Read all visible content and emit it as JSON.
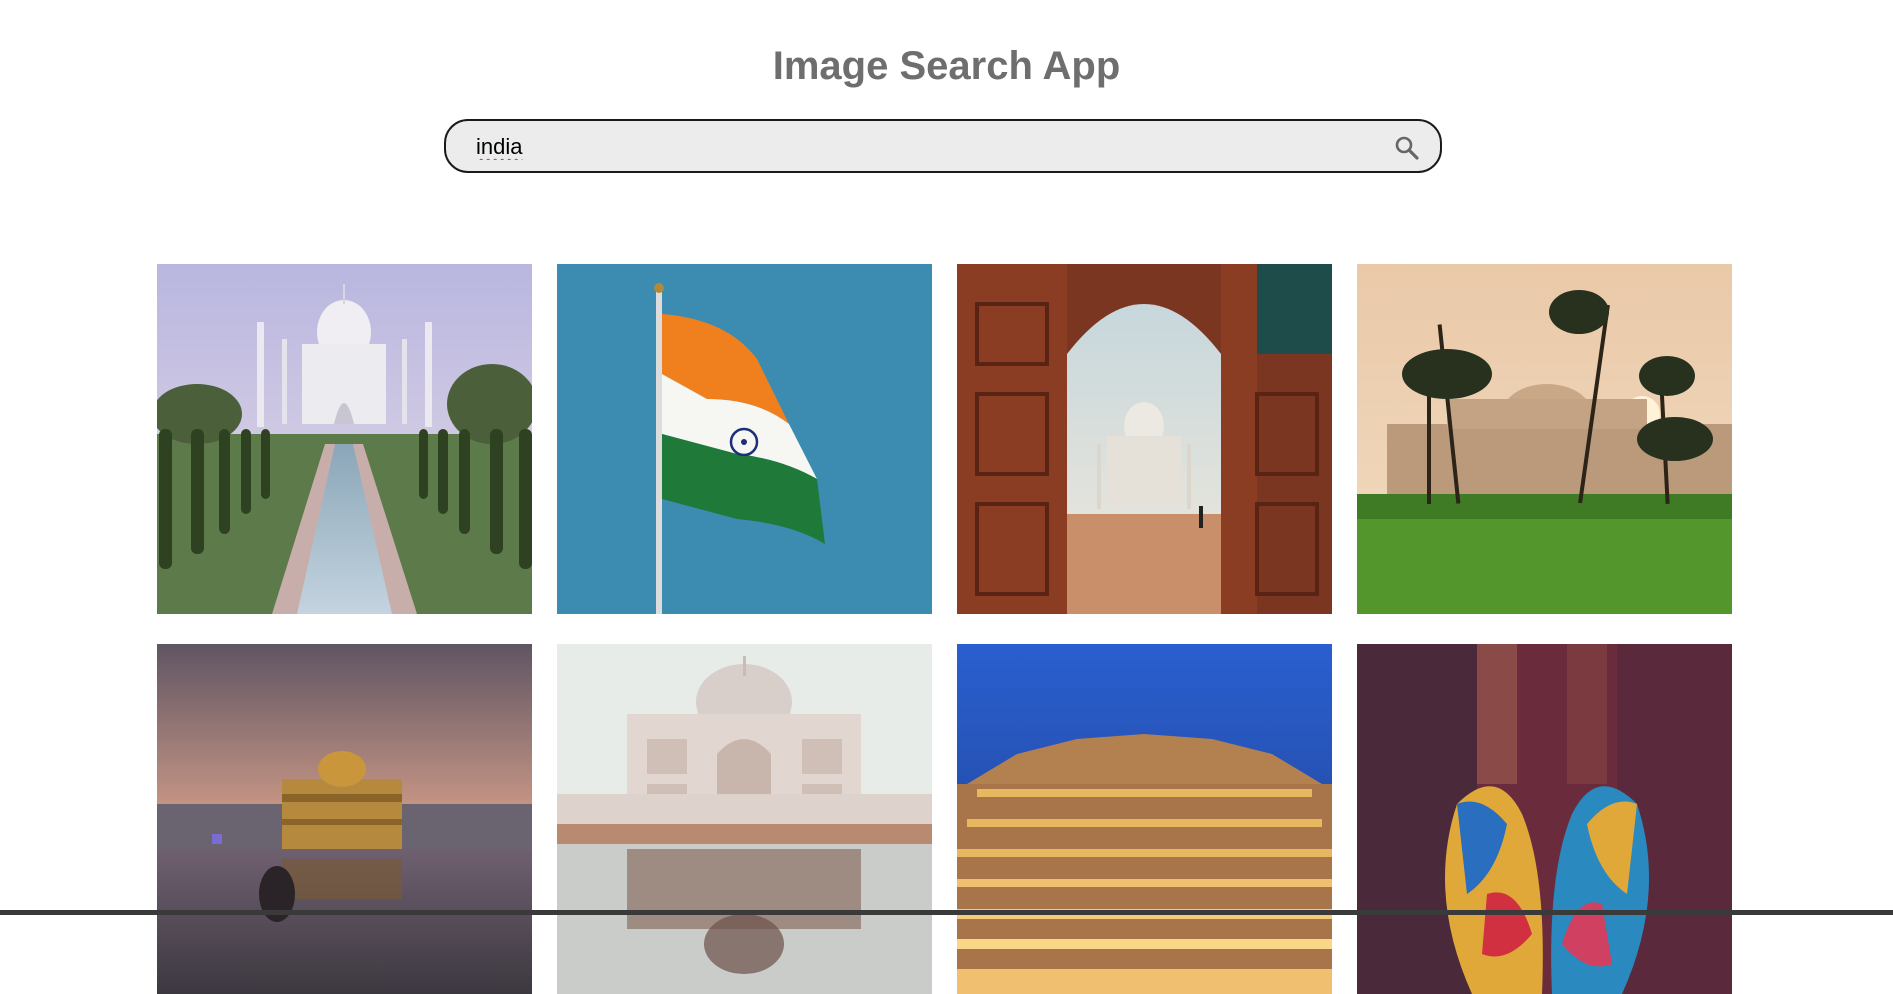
{
  "app": {
    "title": "Image Search App"
  },
  "search": {
    "value": "india",
    "icon": "search-icon"
  },
  "results": [
    {
      "subject": "taj-mahal-garden-reflection"
    },
    {
      "subject": "indian-flag"
    },
    {
      "subject": "taj-mahal-through-arch"
    },
    {
      "subject": "humayun-tomb-palms"
    },
    {
      "subject": "golden-temple-sunset"
    },
    {
      "subject": "taj-mahal-reflection-pool"
    },
    {
      "subject": "hawa-mahal-night"
    },
    {
      "subject": "holi-color-hands"
    }
  ]
}
